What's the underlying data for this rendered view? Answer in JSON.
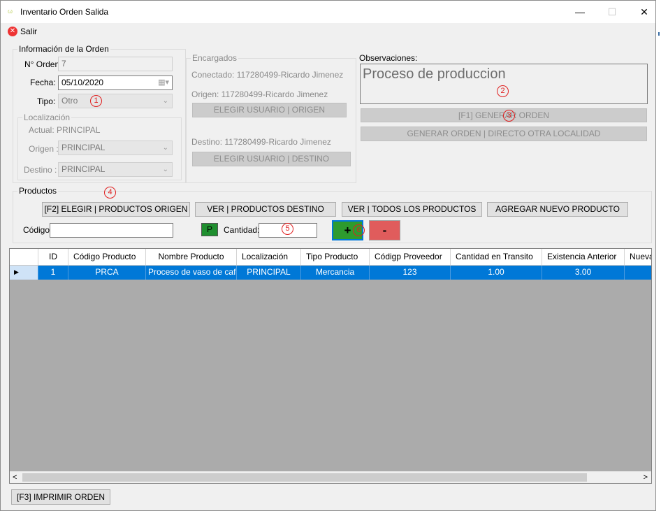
{
  "window": {
    "title": "Inventario Orden Salida",
    "icon": "app-icon",
    "minimize": "—",
    "maximize": "☐",
    "close": "✕"
  },
  "toolbar": {
    "exit_label": "Salir"
  },
  "order_info": {
    "legend": "Información de la Orden",
    "number_label": "N° Orden:",
    "number_value": "7",
    "date_label": "Fecha:",
    "date_value": "05/10/2020",
    "type_label": "Tipo:",
    "type_value": "Otro",
    "location_legend": "Localización",
    "current_label": "Actual: PRINCIPAL",
    "origin_label": "Origen :",
    "origin_value": "PRINCIPAL",
    "dest_label": "Destino :",
    "dest_value": "PRINCIPAL"
  },
  "managers": {
    "legend": "Encargados",
    "connected": "Conectado: 117280499-Ricardo Jimenez",
    "origin": "Origen:   117280499-Ricardo Jimenez",
    "choose_origin_button": "ELEGIR USUARIO | ORIGEN",
    "destination": "Destino:  117280499-Ricardo Jimenez",
    "choose_dest_button": "ELEGIR USUARIO | DESTINO"
  },
  "observations": {
    "label": "Observaciones:",
    "text": "Proceso de produccion",
    "generate_button": "[F1]   GENERAR ORDEN",
    "generate_direct_button": "GENERAR ORDEN | DIRECTO OTRA LOCALIDAD"
  },
  "products": {
    "legend": "Productos",
    "choose_origin_products": "[F2]  ELEGIR | PRODUCTOS ORIGEN",
    "view_dest_products": "VER | PRODUCTOS DESTINO",
    "view_all_products": "VER | TODOS LOS PRODUCTOS",
    "add_new_product": "AGREGAR NUEVO PRODUCTO",
    "code_label": "Código:",
    "code_value": "",
    "p_button": "P",
    "quantity_label": "Cantidad:",
    "quantity_value": "",
    "plus_button": "+",
    "minus_button": "-"
  },
  "markers": [
    "1",
    "2",
    "3",
    "4",
    "5",
    "6"
  ],
  "table": {
    "columns": [
      "ID",
      "Código Producto",
      "Nombre Producto",
      "Localización",
      "Tipo Producto",
      "Códigp Proveedor",
      "Cantidad en Transito",
      "Existencia Anterior",
      "Nueva"
    ],
    "rows": [
      [
        "1",
        "PRCA",
        "Proceso de vaso de cafe",
        "PRINCIPAL",
        "Mercancia",
        "123",
        "1.00",
        "3.00",
        ""
      ]
    ],
    "scroll_left": "<",
    "scroll_right": ">",
    "row_marker": "▶"
  },
  "footer": {
    "print_button": "[F3]  IMPRIMIR ORDEN"
  },
  "colors": {
    "accent": "#0078d7",
    "plus": "#2e9b2e",
    "minus": "#e05c5c",
    "marker": "#e02020"
  }
}
